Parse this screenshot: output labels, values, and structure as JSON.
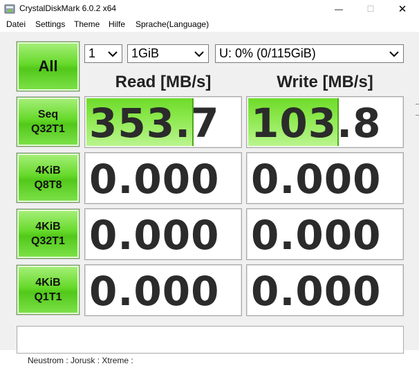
{
  "window": {
    "title": "CrystalDiskMark 6.0.2 x64",
    "min_label": "—",
    "max_label": "☐",
    "close_label": "✕"
  },
  "menu": {
    "items": [
      "Datei",
      "Settings",
      "Theme",
      "Hilfe",
      "Sprache(Language)"
    ]
  },
  "controls": {
    "all_label": "All",
    "count_value": "1",
    "size_value": "1GiB",
    "drive_value": "U: 0% (0/115GiB)"
  },
  "headers": {
    "read": "Read [MB/s]",
    "write": "Write [MB/s]"
  },
  "tests": [
    {
      "label": "Seq\nQ32T1",
      "read": "353.7",
      "write": "103.8",
      "read_fill_fraction": 0.7,
      "write_fill_fraction": 0.59
    },
    {
      "label": "4KiB\nQ8T8",
      "read": "0.000",
      "write": "0.000",
      "read_fill_fraction": 0,
      "write_fill_fraction": 0
    },
    {
      "label": "4KiB\nQ32T1",
      "read": "0.000",
      "write": "0.000",
      "read_fill_fraction": 0,
      "write_fill_fraction": 0
    },
    {
      "label": "4KiB\nQ1T1",
      "read": "0.000",
      "write": "0.000",
      "read_fill_fraction": 0,
      "write_fill_fraction": 0
    }
  ],
  "comment": "",
  "background_text": "Neustrom : Jorusk : Xtreme :",
  "colors": {
    "accent_green": "#66d92a",
    "bar_green": "#8be84c"
  },
  "icons": {
    "app": "crystaldiskmark-icon",
    "dropdown": "chevron-down-icon"
  }
}
